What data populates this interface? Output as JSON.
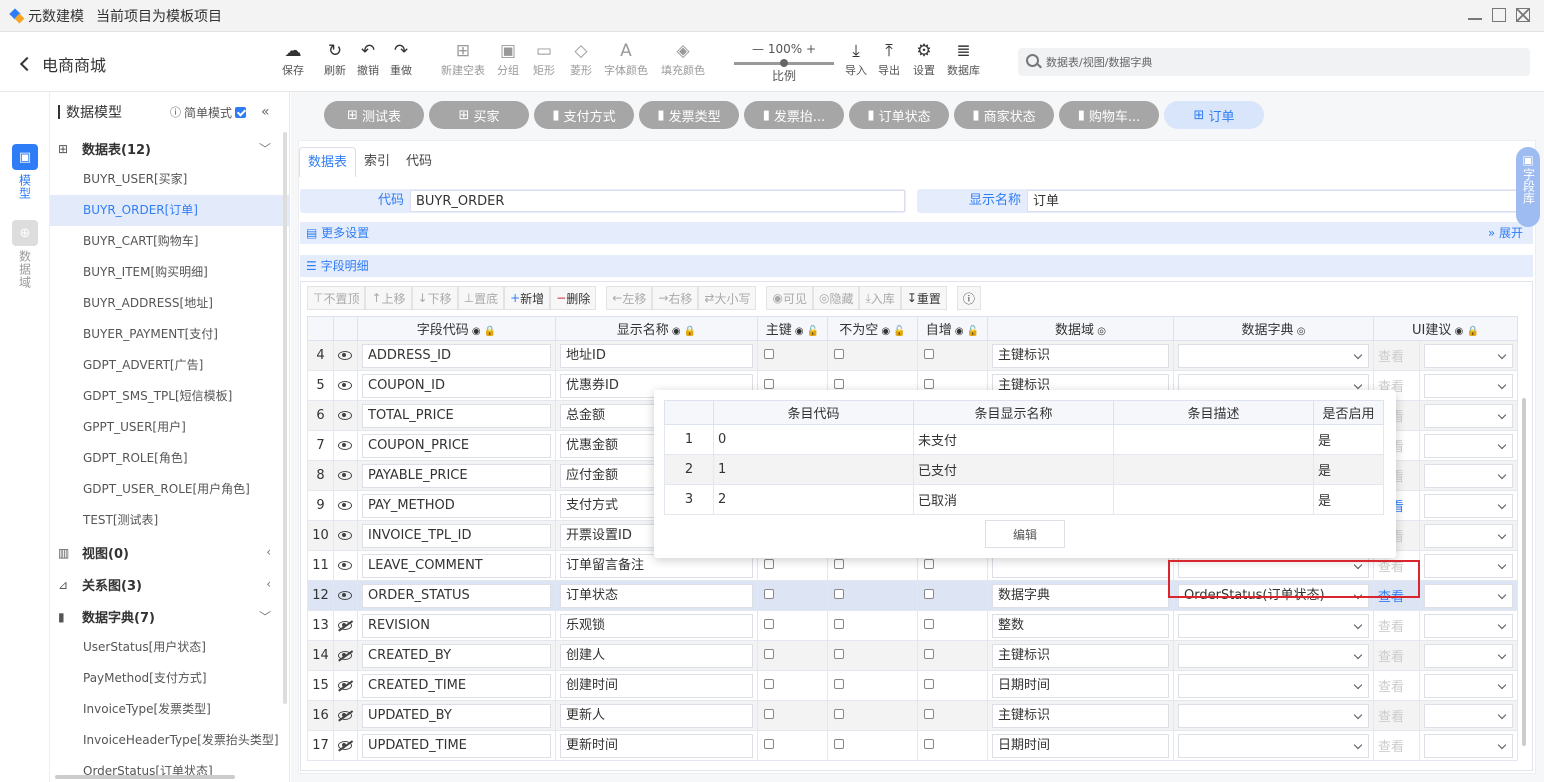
{
  "window": {
    "app_name": "元数建模",
    "project_label": "当前项目为模板项目"
  },
  "header": {
    "back_title": "电商商城",
    "search_placeholder": "数据表/视图/数据字典"
  },
  "toolbar": {
    "items": [
      {
        "label": "保存",
        "icon": "cloud-upload-icon"
      },
      {
        "label": "刷新",
        "icon": "refresh-icon"
      },
      {
        "label": "撤销",
        "icon": "undo-icon"
      },
      {
        "label": "重做",
        "icon": "redo-icon"
      },
      {
        "label": "新建空表",
        "icon": "new-table-icon"
      },
      {
        "label": "分组",
        "icon": "group-icon"
      },
      {
        "label": "矩形",
        "icon": "rectangle-icon"
      },
      {
        "label": "菱形",
        "icon": "diamond-icon"
      },
      {
        "label": "字体颜色",
        "icon": "font-color-icon"
      },
      {
        "label": "填充颜色",
        "icon": "fill-color-icon"
      },
      {
        "label": "导入",
        "icon": "import-icon"
      },
      {
        "label": "导出",
        "icon": "export-icon"
      },
      {
        "label": "设置",
        "icon": "gear-icon"
      },
      {
        "label": "数据库",
        "icon": "database-icon"
      }
    ],
    "zoom_value": "100%",
    "zoom_label": "比例"
  },
  "rail": {
    "model": "模型",
    "domain": "数据域"
  },
  "sidebar": {
    "title": "数据模型",
    "simple_mode": "简单模式",
    "tables_group": "数据表(12)",
    "tables": [
      "BUYR_USER[买家]",
      "BUYR_ORDER[订单]",
      "BUYR_CART[购物车]",
      "BUYR_ITEM[购买明细]",
      "BUYR_ADDRESS[地址]",
      "BUYER_PAYMENT[支付]",
      "GDPT_ADVERT[广告]",
      "GDPT_SMS_TPL[短信模板]",
      "GPPT_USER[用户]",
      "GDPT_ROLE[角色]",
      "GDPT_USER_ROLE[用户角色]",
      "TEST[测试表]"
    ],
    "views_group": "视图(0)",
    "relations_group": "关系图(3)",
    "dicts_group": "数据字典(7)",
    "dicts": [
      "UserStatus[用户状态]",
      "PayMethod[支付方式]",
      "InvoiceType[发票类型]",
      "InvoiceHeaderType[发票抬头类型]",
      "OrderStatus[订单状态]"
    ]
  },
  "tabs": [
    "测试表",
    "买家",
    "支付方式",
    "发票类型",
    "发票抬...",
    "订单状态",
    "商家状态",
    "购物车...",
    "订单"
  ],
  "subtabs": [
    "数据表",
    "索引",
    "代码"
  ],
  "form": {
    "code_label": "代码",
    "code_value": "BUYR_ORDER",
    "name_label": "显示名称",
    "name_value": "订单",
    "more_settings": "更多设置",
    "expand": "展开",
    "fields_detail": "字段明细"
  },
  "grid_toolbar": [
    "不置顶",
    "上移",
    "下移",
    "置底",
    "新增",
    "删除",
    "左移",
    "右移",
    "大小写",
    "可见",
    "隐藏",
    "入库",
    "重置"
  ],
  "columns": [
    "字段代码",
    "显示名称",
    "主键",
    "不为空",
    "自增",
    "数据域",
    "数据字典",
    "UI建议"
  ],
  "rows": [
    {
      "n": "4",
      "code": "ADDRESS_ID",
      "name": "地址ID",
      "domain": "主键标识",
      "dict": "",
      "look": "查看"
    },
    {
      "n": "5",
      "code": "COUPON_ID",
      "name": "优惠券ID",
      "domain": "主键标识",
      "dict": "",
      "look": "查看"
    },
    {
      "n": "6",
      "code": "TOTAL_PRICE",
      "name": "总金额",
      "domain": "",
      "dict": "",
      "look": "查看"
    },
    {
      "n": "7",
      "code": "COUPON_PRICE",
      "name": "优惠金额",
      "domain": "",
      "dict": "",
      "look": "查看"
    },
    {
      "n": "8",
      "code": "PAYABLE_PRICE",
      "name": "应付金额",
      "domain": "",
      "dict": "",
      "look": "查看"
    },
    {
      "n": "9",
      "code": "PAY_METHOD",
      "name": "支付方式",
      "domain": "",
      "dict": "",
      "look": "查看"
    },
    {
      "n": "10",
      "code": "INVOICE_TPL_ID",
      "name": "开票设置ID",
      "domain": "",
      "dict": "",
      "look": "查看"
    },
    {
      "n": "11",
      "code": "LEAVE_COMMENT",
      "name": "订单留言备注",
      "domain": "",
      "dict": "",
      "look": "查看"
    },
    {
      "n": "12",
      "code": "ORDER_STATUS",
      "name": "订单状态",
      "domain": "数据字典",
      "dict": "OrderStatus(订单状态)",
      "look": "查看"
    },
    {
      "n": "13",
      "code": "REVISION",
      "name": "乐观锁",
      "domain": "整数",
      "dict": "",
      "look": "查看"
    },
    {
      "n": "14",
      "code": "CREATED_BY",
      "name": "创建人",
      "domain": "主键标识",
      "dict": "",
      "look": "查看"
    },
    {
      "n": "15",
      "code": "CREATED_TIME",
      "name": "创建时间",
      "domain": "日期时间",
      "dict": "",
      "look": "查看"
    },
    {
      "n": "16",
      "code": "UPDATED_BY",
      "name": "更新人",
      "domain": "主键标识",
      "dict": "",
      "look": "查看"
    },
    {
      "n": "17",
      "code": "UPDATED_TIME",
      "name": "更新时间",
      "domain": "日期时间",
      "dict": "",
      "look": "查看"
    }
  ],
  "popup": {
    "columns": [
      "条目代码",
      "条目显示名称",
      "条目描述",
      "是否启用"
    ],
    "rows": [
      {
        "n": "1",
        "code": "0",
        "name": "未支付",
        "desc": "",
        "enabled": "是"
      },
      {
        "n": "2",
        "code": "1",
        "name": "已支付",
        "desc": "",
        "enabled": "是"
      },
      {
        "n": "3",
        "code": "2",
        "name": "已取消",
        "desc": "",
        "enabled": "是"
      }
    ],
    "edit": "编辑"
  },
  "field_library": "字段库",
  "colors": {
    "accent": "#2f7df6",
    "tab_gray": "#a6a6a6",
    "highlight": "#d9262e"
  }
}
